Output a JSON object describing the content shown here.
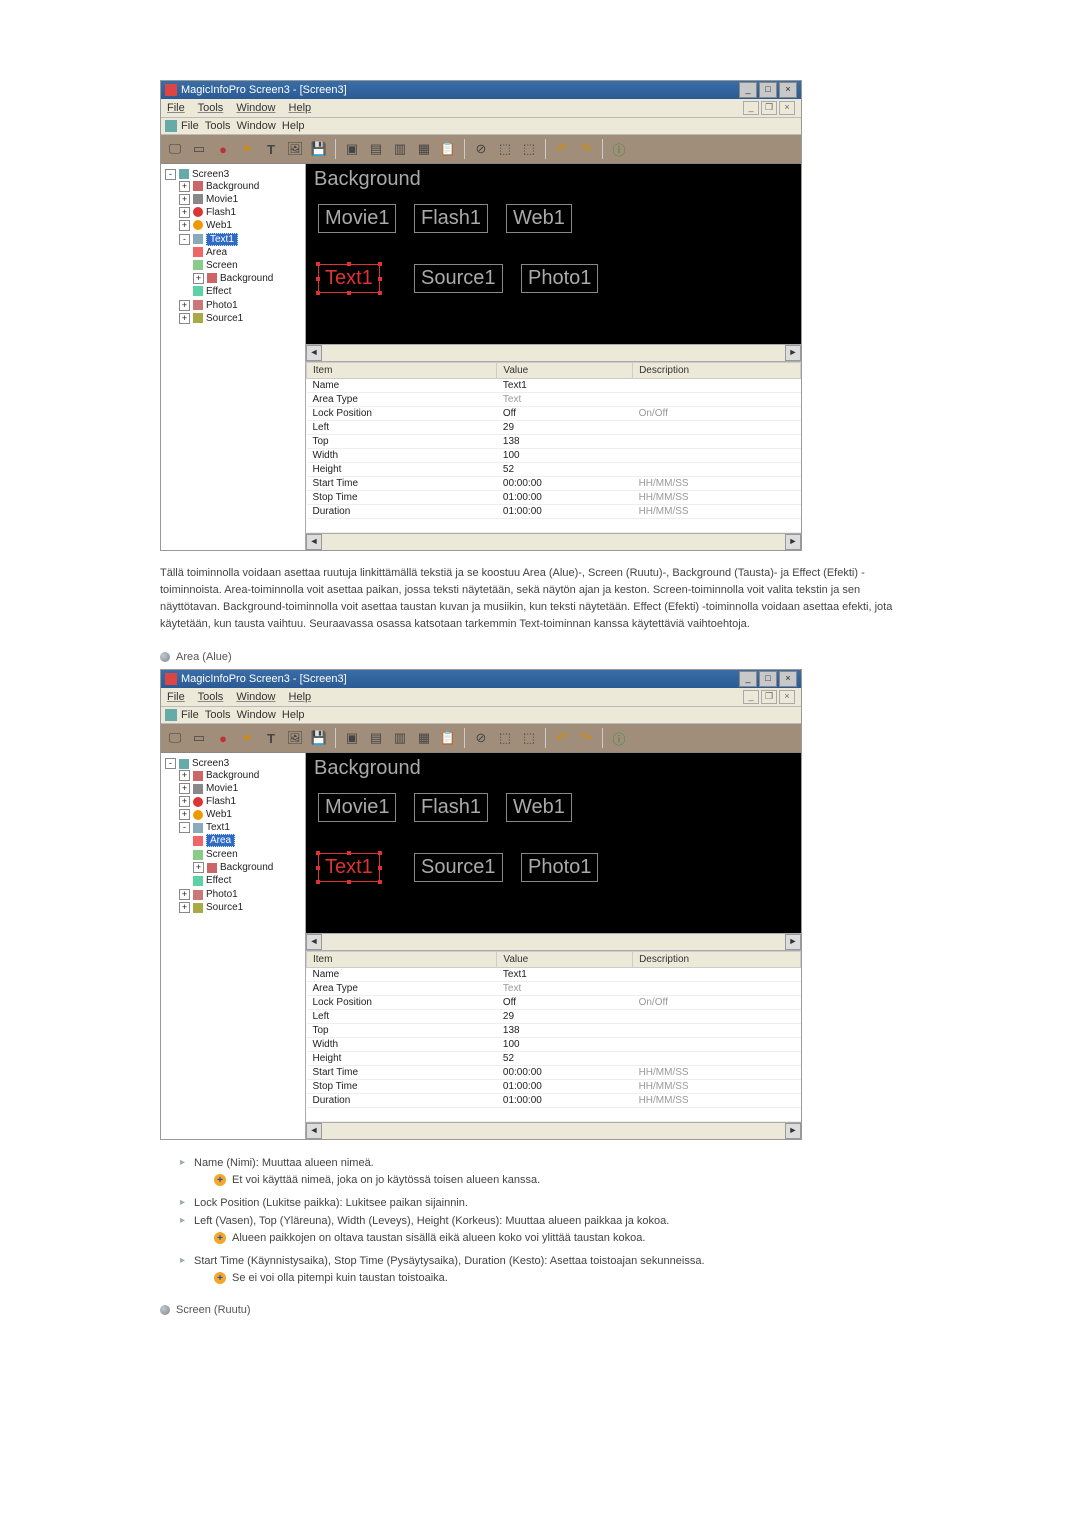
{
  "app": {
    "title": "MagicInfoPro Screen3 - [Screen3]",
    "menus": [
      "File",
      "Tools",
      "Window",
      "Help"
    ]
  },
  "tree": {
    "root": "Screen3",
    "items": [
      {
        "label": "Background"
      },
      {
        "label": "Movie1"
      },
      {
        "label": "Flash1"
      },
      {
        "label": "Web1"
      },
      {
        "label": "Text1"
      },
      {
        "label": "Area"
      },
      {
        "label": "Screen"
      },
      {
        "label": "Background"
      },
      {
        "label": "Effect"
      },
      {
        "label": "Photo1"
      },
      {
        "label": "Source1"
      }
    ],
    "selected_first": "Text1",
    "selected_second": "Area"
  },
  "canvas": {
    "title": "Background",
    "boxes": [
      "Movie1",
      "Flash1",
      "Web1",
      "Text1",
      "Source1",
      "Photo1"
    ]
  },
  "props": {
    "headers": [
      "Item",
      "Value",
      "Description"
    ],
    "rows": [
      {
        "item": "Name",
        "value": "Text1",
        "desc": ""
      },
      {
        "item": "Area Type",
        "value": "Text",
        "desc": "",
        "dim": true
      },
      {
        "item": "Lock Position",
        "value": "Off",
        "desc": "On/Off",
        "descdim": true
      },
      {
        "item": "Left",
        "value": "29",
        "desc": ""
      },
      {
        "item": "Top",
        "value": "138",
        "desc": ""
      },
      {
        "item": "Width",
        "value": "100",
        "desc": ""
      },
      {
        "item": "Height",
        "value": "52",
        "desc": ""
      },
      {
        "item": "Start Time",
        "value": "00:00:00",
        "desc": "HH/MM/SS",
        "descdim": true
      },
      {
        "item": "Stop Time",
        "value": "01:00:00",
        "desc": "HH/MM/SS",
        "descdim": true
      },
      {
        "item": "Duration",
        "value": "01:00:00",
        "desc": "HH/MM/SS",
        "descdim": true
      }
    ]
  },
  "text": {
    "intro": "Tällä toiminnolla voidaan asettaa ruutuja linkittämällä tekstiä ja se koostuu Area (Alue)-, Screen (Ruutu)-, Background (Tausta)- ja Effect (Efekti) -toiminnoista. Area-toiminnolla voit asettaa paikan, jossa teksti näytetään, sekä näytön ajan ja keston. Screen-toiminnolla voit valita tekstin ja sen näyttötavan. Background-toiminnolla voit asettaa taustan kuvan ja musiikin, kun teksti näytetään. Effect (Efekti) -toiminnolla voidaan asettaa efekti, jota käytetään, kun tausta vaihtuu. Seuraavassa osassa katsotaan tarkemmin Text-toiminnan kanssa käytettäviä vaihtoehtoja.",
    "section_area": "Area (Alue)",
    "notes": {
      "n1": "Name (Nimi): Muuttaa alueen nimeä.",
      "n1a": "Et voi käyttää nimeä, joka on jo käytössä toisen alueen kanssa.",
      "n2": "Lock Position (Lukitse paikka): Lukitsee paikan sijainnin.",
      "n3": "Left (Vasen), Top (Yläreuna), Width (Leveys), Height (Korkeus): Muuttaa alueen paikkaa ja kokoa.",
      "n3a": "Alueen paikkojen on oltava taustan sisällä eikä alueen koko voi ylittää taustan kokoa.",
      "n4": "Start Time (Käynnistysaika), Stop Time (Pysäytysaika), Duration (Kesto): Asettaa toistoajan sekunneissa.",
      "n4a": "Se ei voi olla pitempi kuin taustan toistoaika."
    },
    "section_screen": "Screen (Ruutu)"
  }
}
